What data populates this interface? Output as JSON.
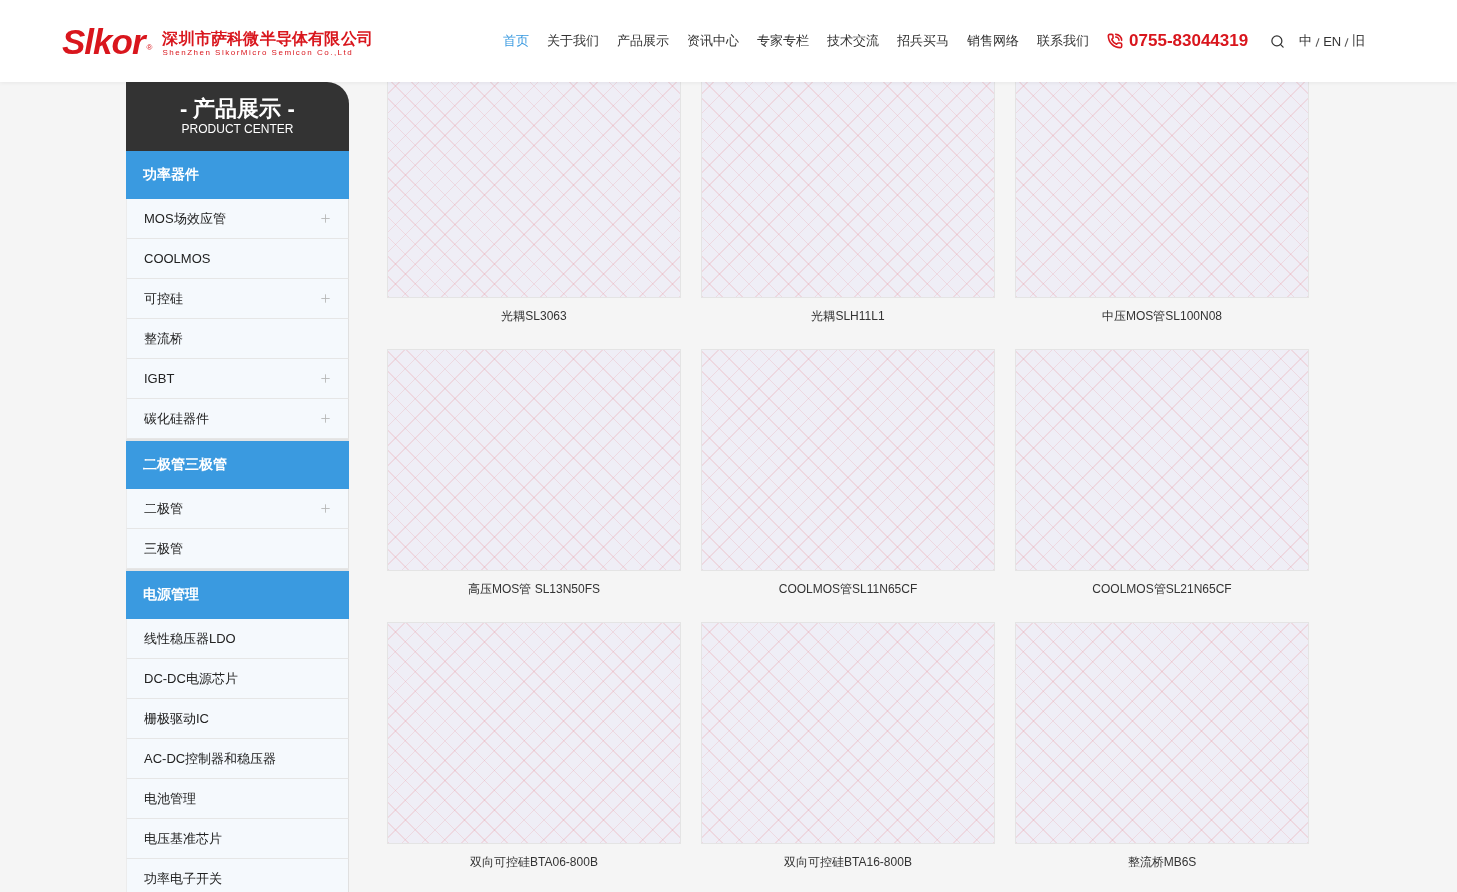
{
  "header": {
    "logo": {
      "wordmark": "Slkor",
      "registered": "®",
      "company_cn": "深圳市萨科微半导体有限公司",
      "company_en": "ShenZhen SlkorMicro Semicon Co.,Ltd"
    },
    "nav": [
      {
        "label": "首页",
        "selected": true
      },
      {
        "label": "关于我们",
        "selected": false
      },
      {
        "label": "产品展示",
        "selected": false
      },
      {
        "label": "资讯中心",
        "selected": false
      },
      {
        "label": "专家专栏",
        "selected": false
      },
      {
        "label": "技术交流",
        "selected": false
      },
      {
        "label": "招兵买马",
        "selected": false
      },
      {
        "label": "销售网络",
        "selected": false
      },
      {
        "label": "联系我们",
        "selected": false
      }
    ],
    "phone": "0755-83044319",
    "languages": [
      {
        "label": "中"
      },
      {
        "label": "EN"
      },
      {
        "label": "旧"
      }
    ]
  },
  "sidebar": {
    "title": "- 产品展示 -",
    "subtitle": "PRODUCT CENTER",
    "groups": [
      {
        "label": "功率器件",
        "items": [
          {
            "label": "MOS场效应管",
            "expandable": true
          },
          {
            "label": "COOLMOS",
            "expandable": false
          },
          {
            "label": "可控硅",
            "expandable": true
          },
          {
            "label": "整流桥",
            "expandable": false
          },
          {
            "label": "IGBT",
            "expandable": true
          },
          {
            "label": "碳化硅器件",
            "expandable": true
          }
        ]
      },
      {
        "label": "二极管三极管",
        "items": [
          {
            "label": "二极管",
            "expandable": true
          },
          {
            "label": "三极管",
            "expandable": false
          }
        ]
      },
      {
        "label": "电源管理",
        "items": [
          {
            "label": "线性稳压器LDO",
            "expandable": false
          },
          {
            "label": "DC-DC电源芯片",
            "expandable": false
          },
          {
            "label": "栅极驱动IC",
            "expandable": false
          },
          {
            "label": "AC-DC控制器和稳压器",
            "expandable": false
          },
          {
            "label": "电池管理",
            "expandable": false
          },
          {
            "label": "电压基准芯片",
            "expandable": false
          },
          {
            "label": "功率电子开关",
            "expandable": false
          }
        ]
      }
    ]
  },
  "products": [
    {
      "name": "光耦SL3063"
    },
    {
      "name": "光耦SLH11L1"
    },
    {
      "name": "中压MOS管SL100N08"
    },
    {
      "name": "高压MOS管 SL13N50FS"
    },
    {
      "name": "COOLMOS管SL11N65CF"
    },
    {
      "name": "COOLMOS管SL21N65CF"
    },
    {
      "name": "双向可控硅BTA06-800B"
    },
    {
      "name": "双向可控硅BTA16-800B"
    },
    {
      "name": "整流桥MB6S"
    }
  ]
}
